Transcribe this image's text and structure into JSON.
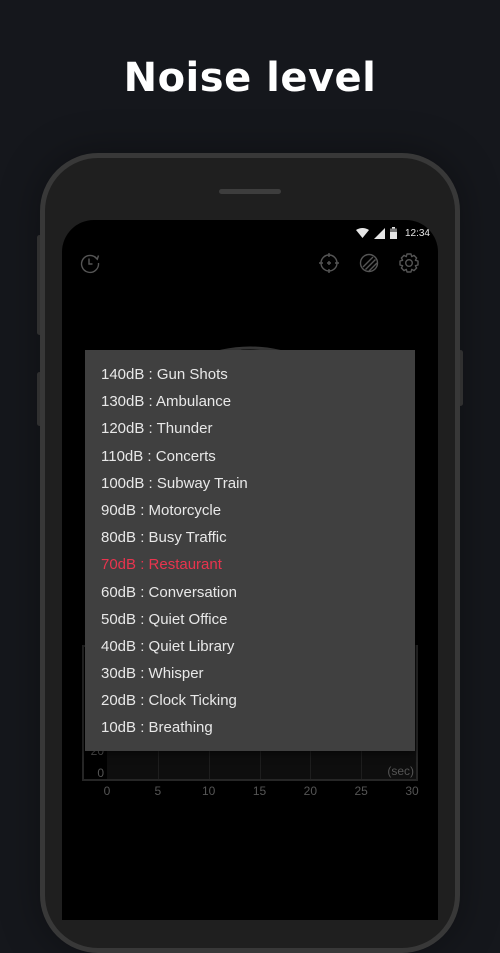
{
  "page": {
    "title": "Noise level"
  },
  "status_bar": {
    "time": "12:34",
    "icons": [
      "wifi-icon",
      "cellular-signal-icon",
      "battery-icon"
    ]
  },
  "toolbar": {
    "left": [
      {
        "icon": "history-icon",
        "label": "History"
      }
    ],
    "right": [
      {
        "icon": "calibrate-crosshair-icon",
        "label": "Calibrate"
      },
      {
        "icon": "theme-toggle-icon",
        "label": "Theme"
      },
      {
        "icon": "settings-gear-icon",
        "label": "Settings"
      }
    ]
  },
  "noise_reference_popup": {
    "highlight_color": "#e8344e",
    "selected_index": 7,
    "items": [
      {
        "label": "140dB : Gun Shots"
      },
      {
        "label": "130dB : Ambulance"
      },
      {
        "label": "120dB : Thunder"
      },
      {
        "label": "110dB : Concerts"
      },
      {
        "label": "100dB : Subway Train"
      },
      {
        "label": "90dB : Motorcycle"
      },
      {
        "label": "80dB : Busy Traffic"
      },
      {
        "label": "70dB : Restaurant"
      },
      {
        "label": "60dB : Conversation"
      },
      {
        "label": "50dB : Quiet Office"
      },
      {
        "label": "40dB : Quiet Library"
      },
      {
        "label": "30dB : Whisper"
      },
      {
        "label": "20dB : Clock Ticking"
      },
      {
        "label": "10dB : Breathing"
      }
    ]
  },
  "chart_data": {
    "type": "line",
    "title": "",
    "xlabel": "(sec)",
    "ylabel": "",
    "x_ticks": [
      "0",
      "5",
      "10",
      "15",
      "20",
      "25",
      "30"
    ],
    "y_ticks_visible": [
      "0",
      "20"
    ],
    "xlim": [
      0,
      30
    ],
    "grid": true,
    "series": []
  }
}
